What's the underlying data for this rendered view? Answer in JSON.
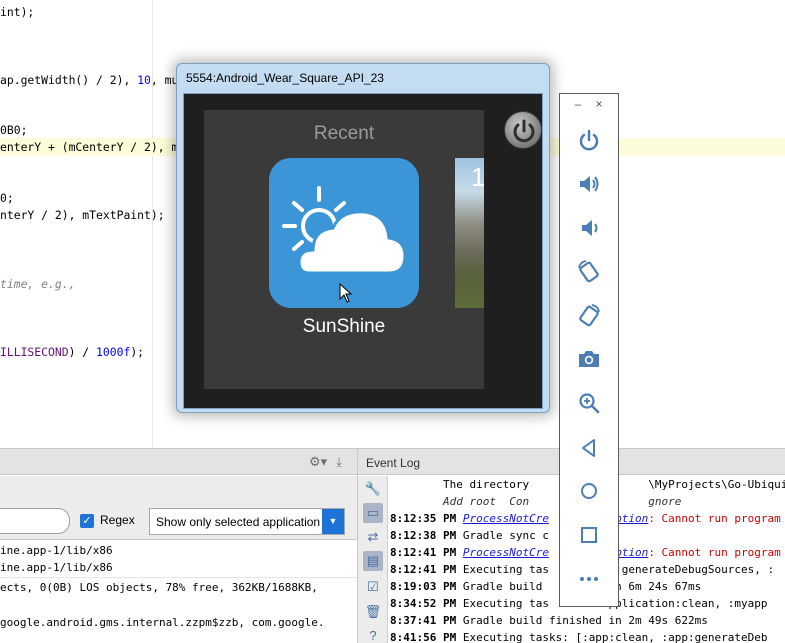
{
  "editor": {
    "lines": [
      {
        "parts": [
          {
            "t": "int);",
            "c": ""
          }
        ]
      },
      {
        "parts": [
          {
            "t": "ap.getWidth() / 2), ",
            "c": ""
          },
          {
            "t": "10",
            "c": "c-num"
          },
          {
            "t": ", mu",
            "c": ""
          }
        ]
      },
      {
        "parts": [
          {
            "t": "0B0;",
            "c": ""
          }
        ]
      },
      {
        "parts": [
          {
            "t": "enterY + (mCenterY / 2), m",
            "c": ""
          }
        ]
      },
      {
        "parts": [
          {
            "t": "0;",
            "c": ""
          }
        ]
      },
      {
        "parts": [
          {
            "t": "nterY / 2), mTextPaint);",
            "c": ""
          }
        ]
      },
      {
        "parts": [
          {
            "t": "time, e.g.,",
            "c": "c-cmt"
          }
        ]
      },
      {
        "parts": [
          {
            "t": "ILLISECOND",
            "c": "c-field"
          },
          {
            "t": ") / ",
            "c": ""
          },
          {
            "t": "1000f",
            "c": "c-num"
          },
          {
            "t": ");",
            "c": ""
          }
        ]
      }
    ]
  },
  "run_panel": {
    "regex_label": "Regex",
    "regex_checked": true,
    "app_filter": "Show only selected application",
    "log_lines": [
      "ine.app-1/lib/x86",
      "ine.app-1/lib/x86",
      "ects, 0(0B) LOS objects, 78% free, 362KB/1688KB,",
      "google.android.gms.internal.zzpm$zzb, com.google."
    ]
  },
  "event_log": {
    "title": "Event Log",
    "entries": [
      {
        "time": "",
        "parts": [
          {
            "t": "        The directory ",
            "c": ""
          },
          {
            "t": "",
            "c": ""
          },
          {
            "t": "                 \\MyProjects\\Go-Ubiquitou",
            "c": ""
          }
        ]
      },
      {
        "time": "",
        "parts": [
          {
            "t": "        Add root  Con",
            "c": "ev-it"
          },
          {
            "t": "                  gnore",
            "c": "ev-it"
          }
        ]
      },
      {
        "time": "8:12:35 PM",
        "parts": [
          {
            "t": "ProcessNotCre",
            "c": "ev-link"
          },
          {
            "t": "          ",
            "c": ""
          },
          {
            "t": "ption",
            "c": "ev-link"
          },
          {
            "t": ": Cannot run program",
            "c": "ev-err"
          }
        ]
      },
      {
        "time": "8:12:38 PM",
        "parts": [
          {
            "t": "Gradle sync c",
            "c": ""
          }
        ]
      },
      {
        "time": "8:12:41 PM",
        "parts": [
          {
            "t": "ProcessNotCre",
            "c": "ev-link"
          },
          {
            "t": "          ",
            "c": ""
          },
          {
            "t": "ption",
            "c": "ev-link"
          },
          {
            "t": ": Cannot run program",
            "c": "ev-err"
          }
        ]
      },
      {
        "time": "8:12:41 PM",
        "parts": [
          {
            "t": "Executing tas",
            "c": ""
          },
          {
            "t": "         p:generateDebugSources, :",
            "c": ""
          }
        ]
      },
      {
        "time": "8:19:03 PM",
        "parts": [
          {
            "t": "Gradle build ",
            "c": ""
          },
          {
            "t": "         in 6m 24s 67ms",
            "c": ""
          }
        ]
      },
      {
        "time": "8:34:52 PM",
        "parts": [
          {
            "t": "Executing tas",
            "c": ""
          },
          {
            "t": "         pplication:clean, :myapp",
            "c": ""
          }
        ]
      },
      {
        "time": "8:37:41 PM",
        "parts": [
          {
            "t": "Gradle build finished in 2m 49s 622ms",
            "c": ""
          }
        ]
      },
      {
        "time": "8:41:56 PM",
        "parts": [
          {
            "t": "Executing tasks: [:app:clean, :app:generateDeb",
            "c": ""
          }
        ]
      }
    ]
  },
  "emulator": {
    "title": "5554:Android_Wear_Square_API_23",
    "recent_label": "Recent",
    "app_name": "SunShine",
    "next_card_text": "1"
  },
  "toolbar": {
    "minimize": "–",
    "close": "×",
    "buttons": [
      {
        "name": "power-icon"
      },
      {
        "name": "volume-up-icon"
      },
      {
        "name": "volume-down-icon"
      },
      {
        "name": "rotate-left-icon"
      },
      {
        "name": "rotate-right-icon"
      },
      {
        "name": "camera-icon"
      },
      {
        "name": "zoom-icon"
      },
      {
        "name": "back-icon"
      },
      {
        "name": "home-icon"
      },
      {
        "name": "overview-icon"
      },
      {
        "name": "more-icon"
      }
    ]
  },
  "colors": {
    "accent": "#1e74d6",
    "error": "#d00000",
    "link": "#1a1ad6",
    "app_card": "#3c95d6"
  }
}
